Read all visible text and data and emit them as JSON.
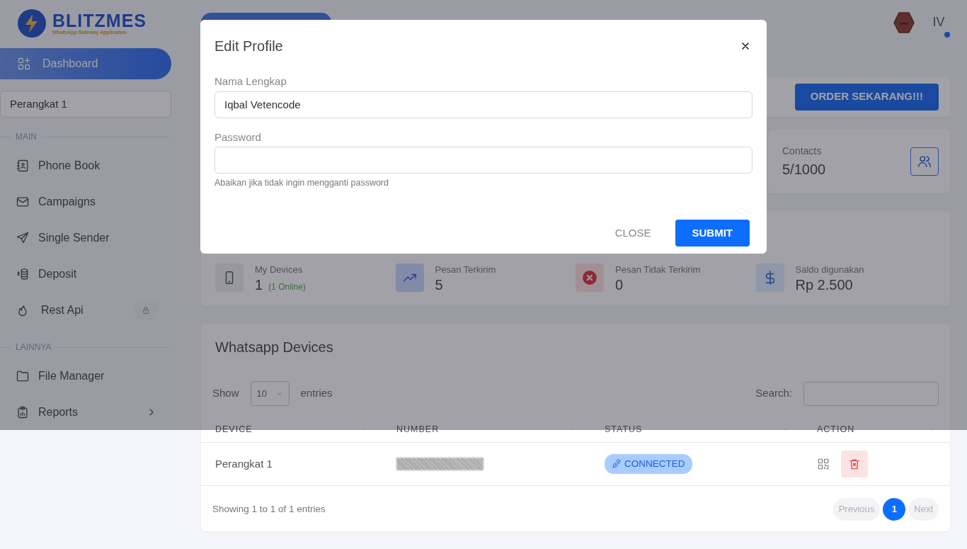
{
  "brand": {
    "name": "BLITZMES",
    "tagline": "WhatsApp Gateway Application"
  },
  "sidebar": {
    "top_item": {
      "label": "Dashboard",
      "selected": true
    },
    "device_select": "Perangkat 1",
    "groups": [
      {
        "title": "MAIN",
        "items": [
          {
            "label": "Phone Book",
            "selected": false,
            "locked": false,
            "expandable": false
          },
          {
            "label": "Campaigns",
            "selected": false,
            "locked": false,
            "expandable": false
          },
          {
            "label": "Single Sender",
            "selected": false,
            "locked": false,
            "expandable": false
          },
          {
            "label": "Deposit",
            "selected": false,
            "locked": false,
            "expandable": false
          },
          {
            "label": "Rest Api",
            "selected": false,
            "locked": true,
            "expandable": false
          }
        ]
      },
      {
        "title": "LAINNYA",
        "items": [
          {
            "label": "File Manager",
            "selected": false,
            "locked": false,
            "expandable": false
          },
          {
            "label": "Reports",
            "selected": false,
            "locked": false,
            "expandable": true
          }
        ]
      }
    ]
  },
  "header": {
    "user_initials": "IV",
    "online": true
  },
  "order_button": "ORDER SEKARANG!!!",
  "contacts": {
    "label": "Contacts",
    "value": "5/1000"
  },
  "stats": [
    {
      "kind": "devices",
      "label": "My Devices",
      "value": "1",
      "note": "(1 Online)"
    },
    {
      "kind": "sent",
      "label": "Pesan Terkirim",
      "value": "5"
    },
    {
      "kind": "failed",
      "label": "Pesan Tidak Terkirim",
      "value": "0"
    },
    {
      "kind": "balance",
      "label": "Saldo digunakan",
      "value": "Rp 2.500"
    }
  ],
  "devices_table": {
    "title": "Whatsapp Devices",
    "show_label": "Show",
    "page_length": "10",
    "entries_label": "entries",
    "search_label": "Search:",
    "columns": [
      "DEVICE",
      "NUMBER",
      "STATUS",
      "ACTION"
    ],
    "rows": [
      {
        "device": "Perangkat 1",
        "status": "CONNECTED"
      }
    ],
    "info": "Showing 1 to 1 of 1 entries",
    "pagination": {
      "previous": "Previous",
      "next": "Next",
      "pages": [
        {
          "label": "1",
          "selected": true
        }
      ]
    }
  },
  "modal": {
    "title": "Edit Profile",
    "fields": [
      {
        "kind": "text",
        "label": "Nama Lengkap",
        "value": "Iqbal Vetencode"
      },
      {
        "kind": "password",
        "label": "Password",
        "help": "Abaikan jika tidak ingin mengganti password"
      }
    ],
    "close_button": "CLOSE",
    "submit_button": "SUBMIT"
  }
}
